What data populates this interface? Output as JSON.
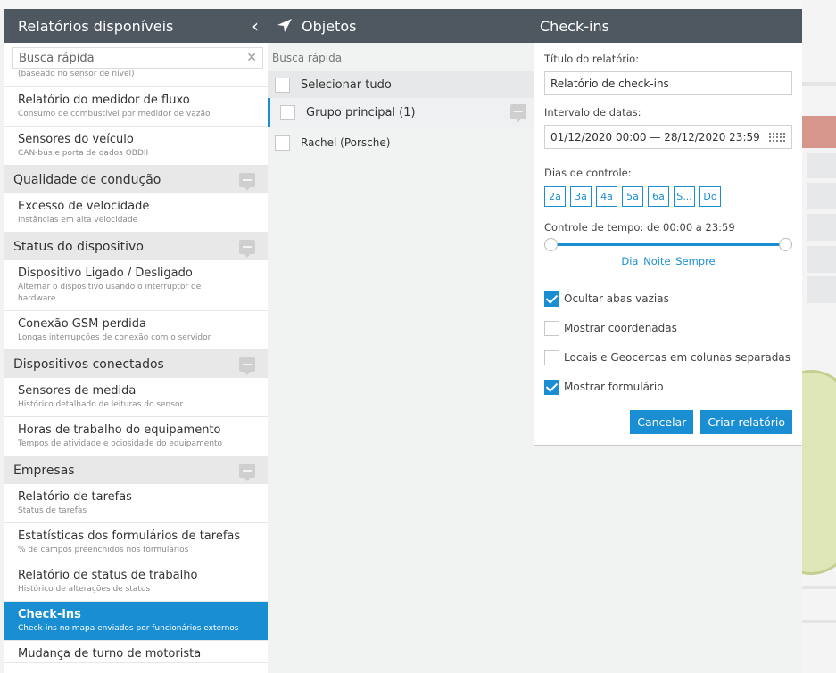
{
  "left": {
    "title": "Relatórios disponíveis",
    "search_placeholder": "Busca rápida",
    "partial_sub": "(baseado no sensor de nível)",
    "item1": {
      "title": "Relatório do medidor de fluxo",
      "sub": "Consumo de combustível por medidor de vazão"
    },
    "item2": {
      "title": "Sensores do veículo",
      "sub": "CAN-bus e porta de dados OBDII"
    },
    "sec1": "Qualidade de condução",
    "item3": {
      "title": "Excesso de velocidade",
      "sub": "Instâncias em alta velocidade"
    },
    "sec2": "Status do dispositivo",
    "item4": {
      "title": "Dispositivo Ligado / Desligado",
      "sub": "Alternar o dispositivo usando o interruptor de hardware"
    },
    "item5": {
      "title": "Conexão GSM perdida",
      "sub": "Longas interrupções de conexão com o servidor"
    },
    "sec3": "Dispositivos conectados",
    "item6": {
      "title": "Sensores de medida",
      "sub": "Histórico detalhado de leituras do sensor"
    },
    "item7": {
      "title": "Horas de trabalho do equipamento",
      "sub": "Tempos de atividade e ociosidade do equipamento"
    },
    "sec4": "Empresas",
    "item8": {
      "title": "Relatório de tarefas",
      "sub": "Status de tarefas"
    },
    "item9": {
      "title": "Estatísticas dos formulários de tarefas",
      "sub": "% de campos preenchidos nos formulários"
    },
    "item10": {
      "title": "Relatório de status de trabalho",
      "sub": "Histórico de alterações de status"
    },
    "item11": {
      "title": "Check-ins",
      "sub": "Check-ins no mapa enviados por funcionários externos"
    },
    "item12": {
      "title": "Mudança de turno de motorista"
    }
  },
  "middle": {
    "title": "Objetos",
    "search_placeholder": "Busca rápida",
    "select_all": "Selecionar tudo",
    "group": "Grupo principal (1)",
    "object": "Rachel (Porsche)"
  },
  "right": {
    "title": "Check-ins",
    "report_title_label": "Título do relatório:",
    "report_title_value": "Relatório de check-ins",
    "date_label": "Intervalo de datas:",
    "date_value": "01/12/2020 00:00 — 28/12/2020 23:59",
    "days_label": "Dias de controle:",
    "days": [
      "2a",
      "3a",
      "4a",
      "5a",
      "6a",
      "S...",
      "Do"
    ],
    "time_label": "Controle de tempo: de 00:00 a 23:59",
    "preset_day": "Dia",
    "preset_night": "Noite",
    "preset_always": "Sempre",
    "opt_hide_empty": "Ocultar abas vazias",
    "opt_coords": "Mostrar coordenadas",
    "opt_places": "Locais e Geocercas em colunas separadas",
    "opt_form": "Mostrar formulário",
    "cancel": "Cancelar",
    "create": "Criar relatório"
  },
  "colors": {
    "accent": "#1a8ed2",
    "header": "#4f5760"
  }
}
